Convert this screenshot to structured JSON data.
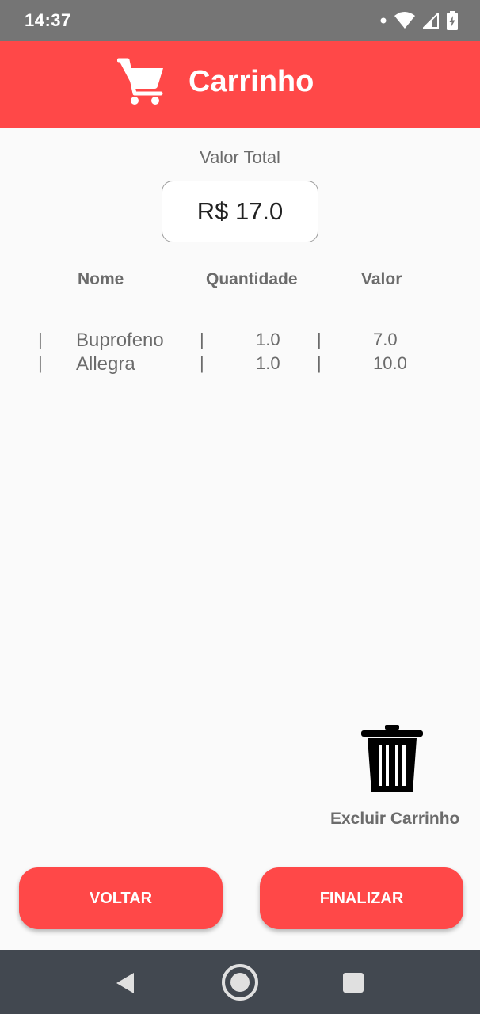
{
  "status_bar": {
    "time": "14:37"
  },
  "app_bar": {
    "title": "Carrinho",
    "icon": "shopping-cart-icon"
  },
  "total": {
    "label": "Valor Total",
    "value": "R$ 17.0"
  },
  "table": {
    "headers": {
      "nome": "Nome",
      "quantidade": "Quantidade",
      "valor": "Valor"
    },
    "separator": "|",
    "rows": [
      {
        "nome": "Buprofeno",
        "quantidade": "1.0",
        "valor": "7.0"
      },
      {
        "nome": "Allegra",
        "quantidade": "1.0",
        "valor": "10.0"
      }
    ]
  },
  "delete_cart": {
    "label": "Excluir Carrinho",
    "icon": "trash-icon"
  },
  "buttons": {
    "back": "VOLTAR",
    "finish": "FINALIZAR"
  },
  "colors": {
    "accent": "#ff4848",
    "status_bar": "#757575",
    "nav_bar": "#424850",
    "background": "#fafafa"
  }
}
